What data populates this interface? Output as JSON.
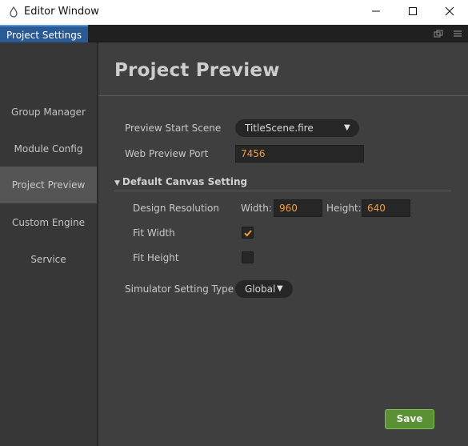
{
  "window": {
    "title": "Editor Window"
  },
  "tabs": [
    {
      "label": "Project Settings"
    }
  ],
  "sidebar": {
    "items": [
      {
        "label": "Group Manager"
      },
      {
        "label": "Module Config"
      },
      {
        "label": "Project Preview"
      },
      {
        "label": "Custom Engine"
      },
      {
        "label": "Service"
      }
    ],
    "active": "Project Preview"
  },
  "main": {
    "title": "Project Preview",
    "preview_start_scene": {
      "label": "Preview Start Scene",
      "value": "TitleScene.fire"
    },
    "web_preview_port": {
      "label": "Web Preview Port",
      "value": "7456"
    },
    "canvas_section": {
      "title": "Default Canvas Setting",
      "design_resolution": {
        "label": "Design Resolution",
        "width_label": "Width:",
        "width": "960",
        "height_label": "Height:",
        "height": "640"
      },
      "fit_width": {
        "label": "Fit Width",
        "checked": true
      },
      "fit_height": {
        "label": "Fit Height",
        "checked": false
      }
    },
    "simulator_setting_type": {
      "label": "Simulator Setting Type",
      "value": "Global"
    },
    "save_label": "Save"
  },
  "colors": {
    "accent_orange": "#f09d3a",
    "tab_blue": "#2a5a96",
    "save_green": "#5a9135",
    "background": "#3f3f3f"
  },
  "icons": [
    "app-icon",
    "minimize-icon",
    "maximize-icon",
    "close-icon",
    "popout-icon",
    "menu-icon",
    "dropdown-arrow-icon",
    "collapse-triangle-icon",
    "checkmark-icon"
  ]
}
